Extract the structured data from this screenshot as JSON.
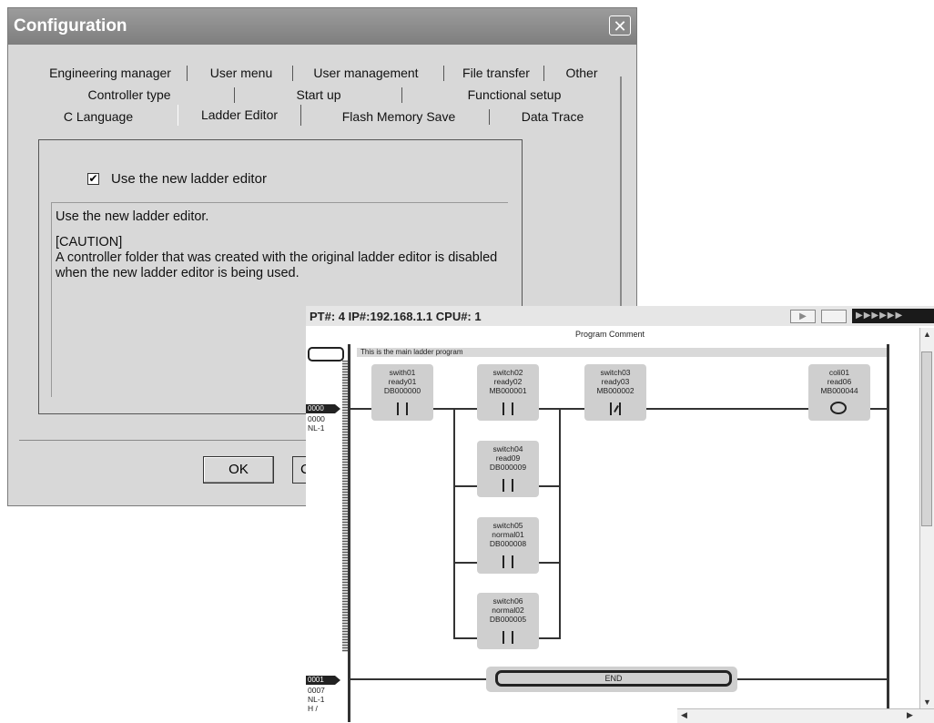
{
  "dialog": {
    "title": "Configuration",
    "close_label": "✕",
    "tabs_row1": [
      "Engineering manager",
      "User menu",
      "User management",
      "File transfer",
      "Other"
    ],
    "tabs_row2": [
      "Controller type",
      "Start up",
      "Functional setup"
    ],
    "tabs_row3": [
      "C Language",
      "Ladder Editor",
      "Flash Memory Save",
      "Data Trace"
    ],
    "active_tab": "Ladder Editor",
    "checkbox_label": "Use the new ladder editor",
    "checkbox_checked": true,
    "description": [
      "Use the new ladder editor.",
      "[CAUTION]",
      "A controller folder that was created with the original ladder editor is disabled",
      "when the new ladder editor is being used."
    ],
    "ok_label": "OK",
    "cancel_label_partial": "C"
  },
  "ladder": {
    "info": "PT#: 4 IP#:192.168.1.1 CPU#: 1",
    "monitor_label": "▶▶▶▶▶▶",
    "program_comment_label": "Program Comment",
    "comment_text": "This is the main ladder program",
    "rung1": {
      "tag": "0000",
      "step": "0000",
      "nl": "NL-1"
    },
    "rung2": {
      "tag": "0001",
      "step": "0007",
      "nl": "NL-1",
      "extra": "H /"
    },
    "elements": [
      {
        "l1": "swith01",
        "l2": "ready01",
        "l3": "DB000000",
        "kind": "no-contact"
      },
      {
        "l1": "switch02",
        "l2": "ready02",
        "l3": "MB000001",
        "kind": "no-contact"
      },
      {
        "l1": "switch03",
        "l2": "ready03",
        "l3": "MB000002",
        "kind": "nc-contact"
      },
      {
        "l1": "coli01",
        "l2": "read06",
        "l3": "MB000044",
        "kind": "coil"
      },
      {
        "l1": "switch04",
        "l2": "read09",
        "l3": "DB000009",
        "kind": "no-contact"
      },
      {
        "l1": "switch05",
        "l2": "normal01",
        "l3": "DB000008",
        "kind": "no-contact"
      },
      {
        "l1": "switch06",
        "l2": "normal02",
        "l3": "DB000005",
        "kind": "no-contact"
      }
    ],
    "end_label": "END"
  }
}
